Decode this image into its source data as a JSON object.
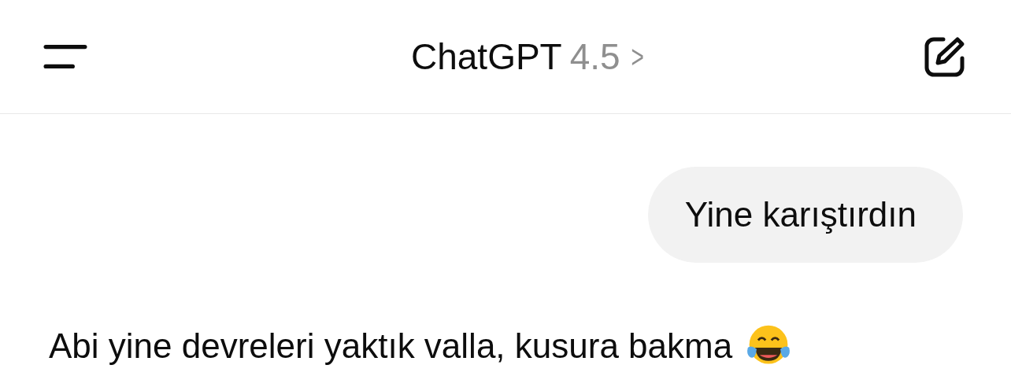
{
  "header": {
    "title": "ChatGPT",
    "model": "4.5",
    "chevron": ">"
  },
  "messages": [
    {
      "kind": "user",
      "parts": [
        {
          "kind": "text",
          "text": "Yine karıştırdın"
        }
      ]
    },
    {
      "kind": "assistant",
      "parts": [
        {
          "kind": "text",
          "text": "Abi yine devreleri yaktık valla, kusura bakma"
        },
        {
          "kind": "emoji"
        }
      ]
    }
  ]
}
